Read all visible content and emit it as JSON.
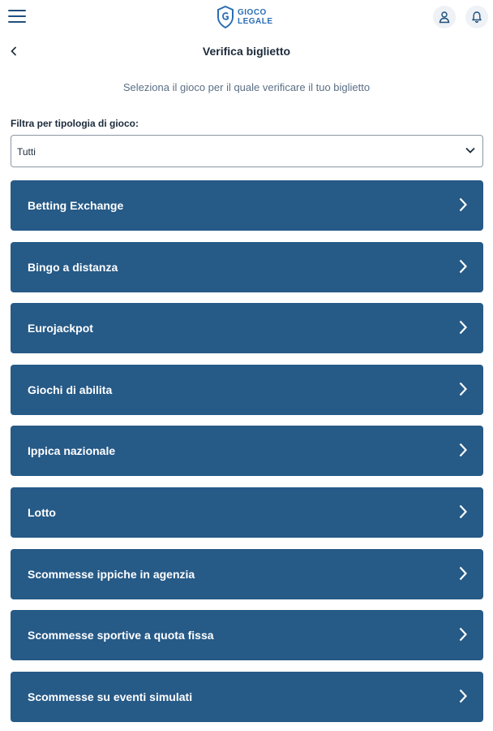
{
  "topbar": {
    "logo_line1": "GIOCO",
    "logo_line2": "LEGALE",
    "icons": [
      "menu-icon",
      "shield-icon",
      "user-icon",
      "bell-icon"
    ]
  },
  "header": {
    "title": "Verifica biglietto",
    "back_icon": "chevron-left-icon"
  },
  "subtitle": "Seleziona il gioco per il quale verificare il tuo biglietto",
  "filter": {
    "label": "Filtra per tipologia di gioco:",
    "selected": "Tutti"
  },
  "games": [
    {
      "label": "Betting Exchange"
    },
    {
      "label": "Bingo a distanza"
    },
    {
      "label": "Eurojackpot"
    },
    {
      "label": "Giochi di abilita"
    },
    {
      "label": "Ippica nazionale"
    },
    {
      "label": "Lotto"
    },
    {
      "label": "Scommesse ippiche in agenzia"
    },
    {
      "label": "Scommesse sportive a quota fissa"
    },
    {
      "label": "Scommesse su eventi simulati"
    }
  ],
  "colors": {
    "primary": "#265a87",
    "brand": "#2a6db5",
    "text": "#1b2a3a",
    "muted": "#5b6f86"
  }
}
